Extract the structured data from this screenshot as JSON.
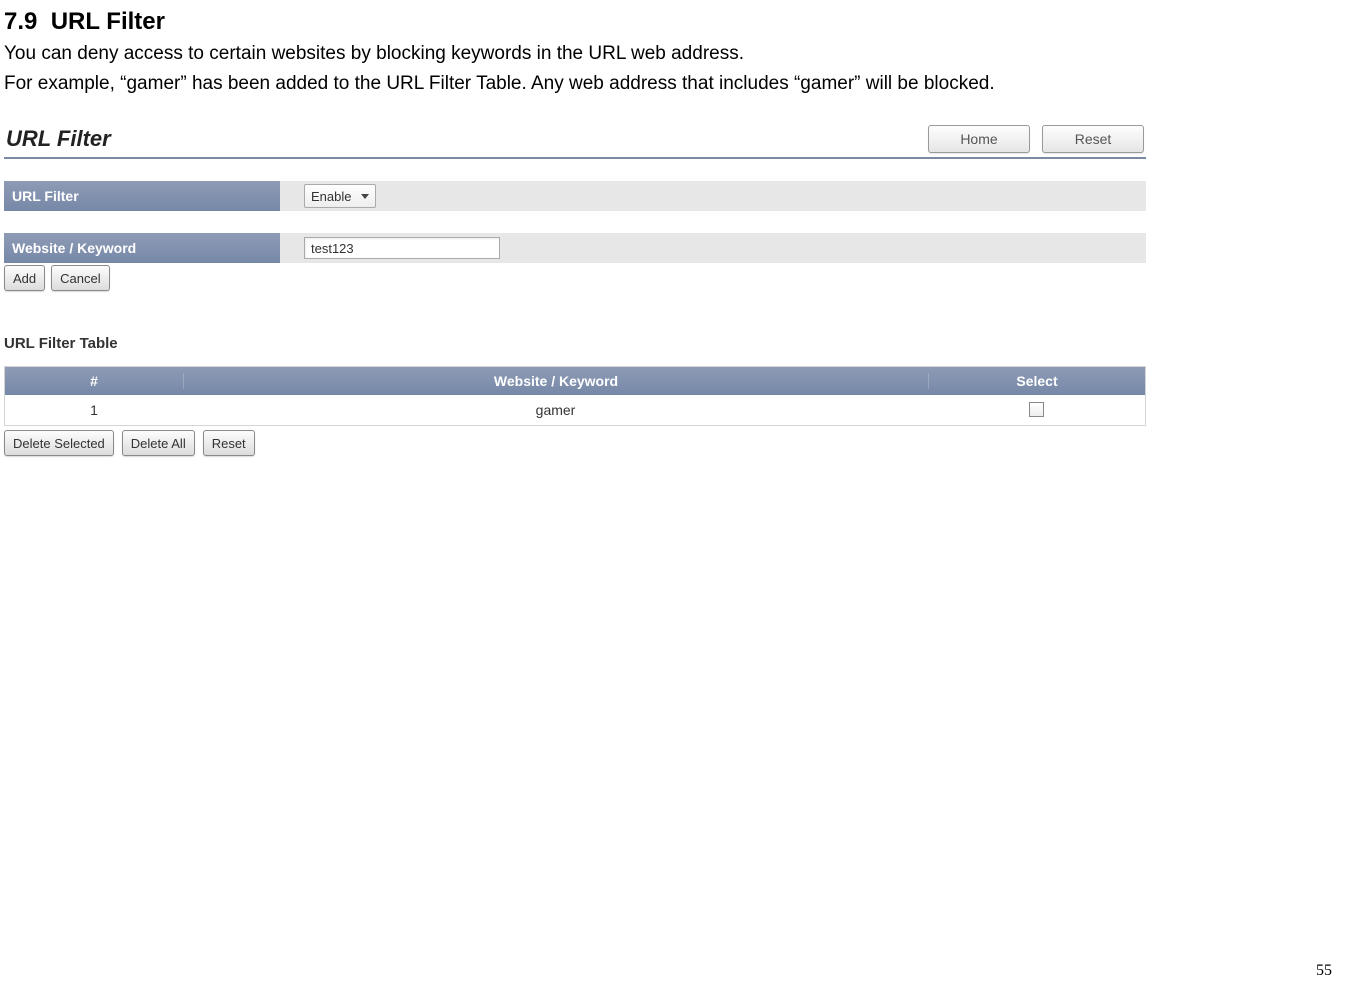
{
  "doc": {
    "section_number": "7.9",
    "section_title": "URL Filter",
    "paragraph1": "You can deny access to certain websites by blocking keywords in the URL web address.",
    "paragraph2": "For example, “gamer” has been added to the URL Filter Table. Any web address that includes “gamer” will be blocked.",
    "page_number": "55"
  },
  "ui": {
    "title": "URL Filter",
    "top_buttons": {
      "home": "Home",
      "reset": "Reset"
    },
    "url_filter": {
      "label": "URL Filter",
      "selected": "Enable"
    },
    "keyword": {
      "label": "Website / Keyword",
      "value": "test123"
    },
    "add_btn": "Add",
    "cancel_btn": "Cancel",
    "table": {
      "title": "URL Filter Table",
      "headers": {
        "num": "#",
        "kw": "Website / Keyword",
        "sel": "Select"
      },
      "row1": {
        "num": "1",
        "kw": "gamer"
      },
      "delete_selected": "Delete Selected",
      "delete_all": "Delete All",
      "reset": "Reset"
    }
  }
}
